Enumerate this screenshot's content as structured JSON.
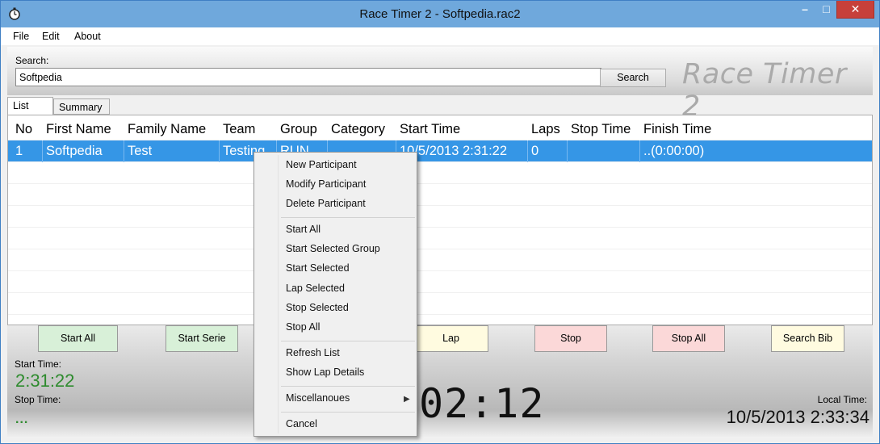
{
  "window": {
    "title": "Race Timer 2 - Softpedia.rac2",
    "minimize_glyph": "–",
    "maximize_glyph": "□",
    "close_glyph": "✕"
  },
  "menu": {
    "file": "File",
    "edit": "Edit",
    "about": "About"
  },
  "search": {
    "label": "Search:",
    "value": "Softpedia",
    "button": "Search"
  },
  "brand": "Race Timer 2",
  "tabs": {
    "list": "List",
    "summary": "Summary"
  },
  "table": {
    "headers": [
      "No",
      "First Name",
      "Family Name",
      "Team",
      "Group",
      "Category",
      "Start Time",
      "Laps",
      "Stop Time",
      "Finish Time"
    ],
    "rows": [
      [
        "1",
        "Softpedia",
        "Test",
        "Testing",
        "RUN",
        "",
        "10/5/2013 2:31:22",
        "0",
        "",
        "..(0:00:00)"
      ]
    ]
  },
  "buttons": {
    "start_all": "Start All",
    "start_serie": "Start Serie",
    "lap": "Lap",
    "stop": "Stop",
    "stop_all": "Stop All",
    "search_bib": "Search Bib"
  },
  "timing": {
    "start_time_label": "Start Time:",
    "start_time_value": "2:31:22",
    "stop_time_label": "Stop Time:",
    "stop_time_value": "...",
    "elapsed": "02:12",
    "local_time_label": "Local Time:",
    "local_time_value": "10/5/2013 2:33:34"
  },
  "context_menu": {
    "new_participant": "New Participant",
    "modify_participant": "Modify Participant",
    "delete_participant": "Delete Participant",
    "start_all": "Start All",
    "start_selected_group": "Start Selected Group",
    "start_selected": "Start Selected",
    "lap_selected": "Lap Selected",
    "stop_selected": "Stop Selected",
    "stop_all": "Stop All",
    "refresh_list": "Refresh List",
    "show_lap_details": "Show Lap Details",
    "miscellaneous": "Miscellanoues",
    "submenu_arrow": "▶",
    "cancel": "Cancel"
  },
  "colors": {
    "titlebar": "#6fa8dc",
    "selection": "#3596e6",
    "close_button": "#c7403a",
    "start_buttons": "#d8f0d8",
    "stop_buttons": "#fbd8d8",
    "neutral_buttons": "#fffbe0",
    "start_time_text": "#2e8b2e"
  },
  "icons": {
    "app": "stopwatch-icon"
  }
}
